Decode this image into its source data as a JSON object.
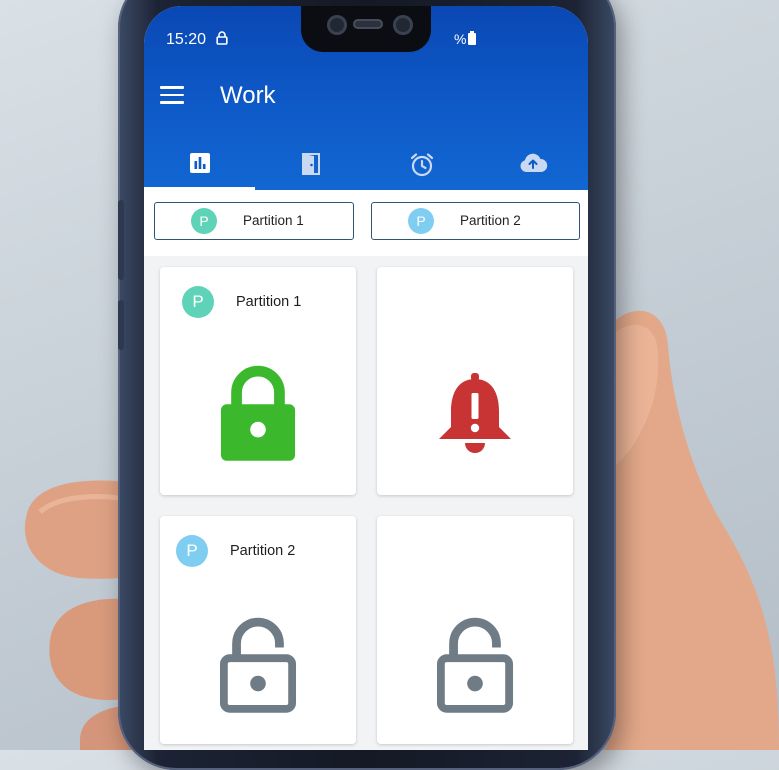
{
  "status_bar": {
    "time": "15:20",
    "battery_text": "%"
  },
  "app_bar": {
    "title": "Work"
  },
  "tabs": [
    {
      "icon": "bar-chart-icon",
      "active": true
    },
    {
      "icon": "door-icon",
      "active": false
    },
    {
      "icon": "alarm-clock-icon",
      "active": false
    },
    {
      "icon": "cloud-upload-icon",
      "active": false
    }
  ],
  "filter_chips": [
    {
      "badge": "P",
      "label": "Partition 1",
      "badge_color": "#5fd3b8"
    },
    {
      "badge": "P",
      "label": "Partition 2",
      "badge_color": "#7fcdf0"
    }
  ],
  "cards": [
    {
      "badge": "P",
      "label": "Partition 1",
      "badge_color": "#5fd3b8",
      "icon": "lock-closed-icon",
      "icon_color": "#3bb82c"
    },
    {
      "icon": "alarm-bell-icon",
      "icon_color": "#c83333"
    },
    {
      "badge": "P",
      "label": "Partition 2",
      "badge_color": "#7fcdf0",
      "icon": "lock-open-icon",
      "icon_color": "#6f7b85"
    },
    {
      "icon": "lock-open-icon",
      "icon_color": "#6f7b85"
    }
  ],
  "colors": {
    "app_bar": "#0e5ac8",
    "chip_border": "#2f5572"
  }
}
